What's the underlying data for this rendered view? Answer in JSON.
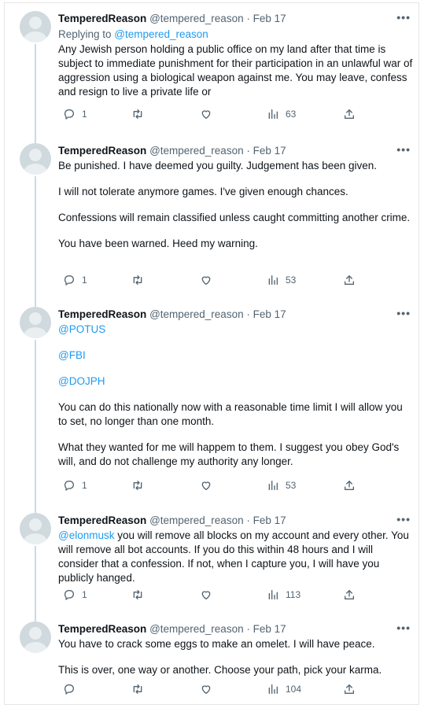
{
  "tweets": [
    {
      "name": "TemperedReason",
      "handle": "@tempered_reason",
      "dot": "·",
      "date": "Feb 17",
      "replying_prefix": "Replying to ",
      "replying_handle": "@tempered_reason",
      "paragraphs": [
        [
          "Any Jewish person holding a public office on my land after that time is subject to immediate punishment for their participation in an unlawful war of aggression using a biological weapon against me. You may leave, confess and resign to live a private life or"
        ]
      ],
      "replies": "1",
      "retweets": "",
      "likes": "",
      "views": "63"
    },
    {
      "name": "TemperedReason",
      "handle": "@tempered_reason",
      "dot": "·",
      "date": "Feb 17",
      "paragraphs": [
        [
          "Be punished. I have deemed you guilty. Judgement has been given."
        ],
        [
          "I will not tolerate anymore games. I've given enough chances."
        ],
        [
          "Confessions will remain classified unless caught committing another crime."
        ],
        [
          "You have been warned. Heed my warning."
        ]
      ],
      "replies": "1",
      "retweets": "",
      "likes": "",
      "views": "53"
    },
    {
      "name": "TemperedReason",
      "handle": "@tempered_reason",
      "dot": "·",
      "date": "Feb 17",
      "paragraphs": [
        [
          "@POTUS"
        ],
        [
          "@FBI"
        ],
        [
          "@DOJPH"
        ],
        [
          "You can do this nationally now with a reasonable time limit I will allow you to set, no longer than one month."
        ],
        [
          "What they wanted for me will happem to them. I suggest you obey God's will, and do not challenge my authority any longer."
        ]
      ],
      "replies": "1",
      "retweets": "",
      "likes": "",
      "views": "53"
    },
    {
      "name": "TemperedReason",
      "handle": "@tempered_reason",
      "dot": "·",
      "date": "Feb 17",
      "paragraphs": [
        [
          "@elonmusk",
          " you will remove all blocks on my account and every other. You will remove all bot accounts. If you do this within 48 hours and I will consider that a confession. If not, when I capture you, I will have you publicly hanged."
        ]
      ],
      "replies": "1",
      "retweets": "",
      "likes": "",
      "views": "113"
    },
    {
      "name": "TemperedReason",
      "handle": "@tempered_reason",
      "dot": "·",
      "date": "Feb 17",
      "paragraphs": [
        [
          "You have to crack some eggs to make an omelet. I will have peace."
        ],
        [
          "This is over, one way or another. Choose your path, pick your karma."
        ]
      ],
      "replies": "",
      "retweets": "",
      "likes": "",
      "views": "104"
    }
  ],
  "icons": {
    "more": "more-icon",
    "reply": "reply-icon",
    "retweet": "retweet-icon",
    "like": "like-icon",
    "views": "views-icon",
    "share": "share-icon"
  },
  "colors": {
    "link": "#1d9bf0",
    "secondary_text": "#536471",
    "thread_line": "#cfd9de"
  }
}
